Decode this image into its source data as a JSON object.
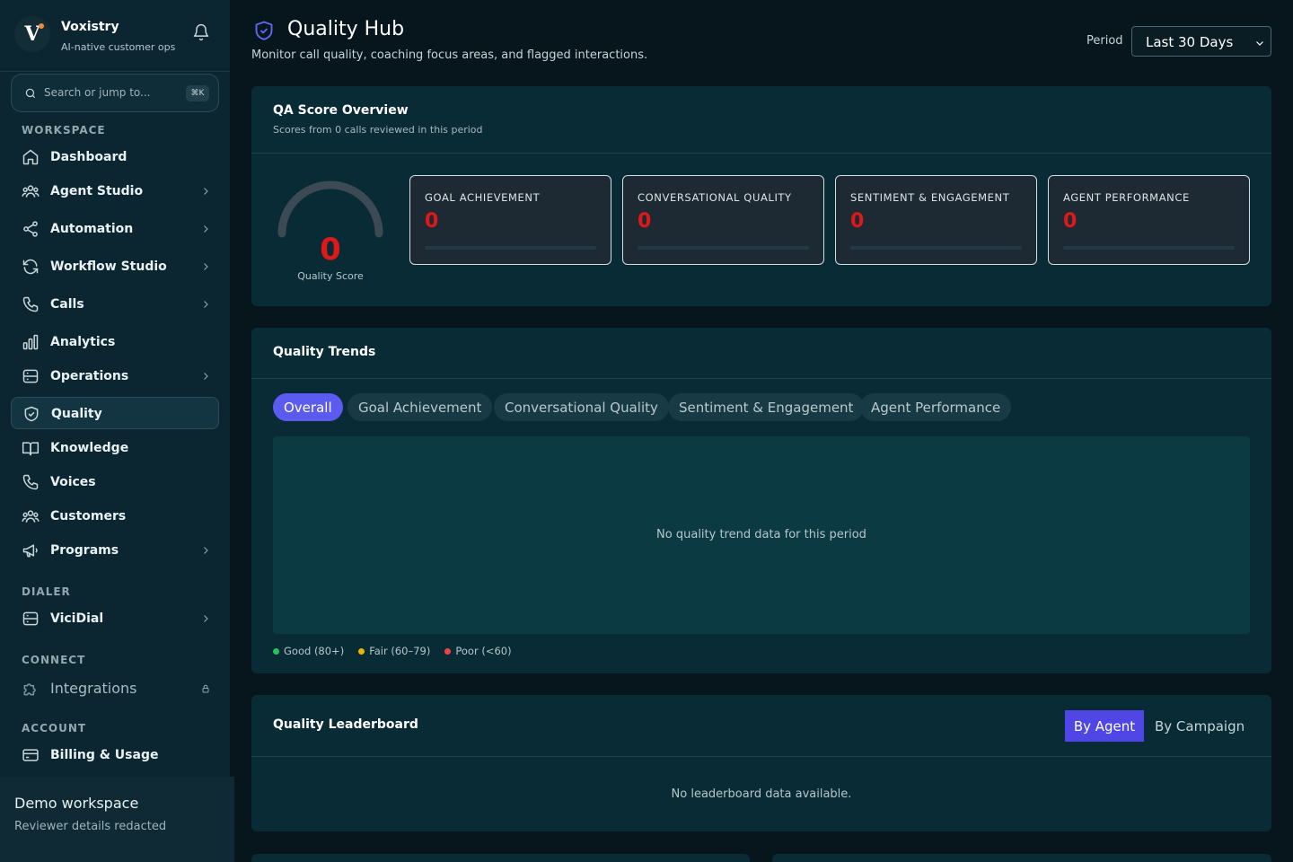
{
  "brand": {
    "logo_letter": "V",
    "name": "Voxistry",
    "tagline": "AI-native customer ops"
  },
  "search": {
    "placeholder": "Search or jump to...",
    "shortcut": "⌘K"
  },
  "sidebar": {
    "sections": {
      "workspace": "WORKSPACE",
      "dialer": "DIALER",
      "connect": "CONNECT",
      "account": "ACCOUNT"
    },
    "items": [
      {
        "label": "Dashboard",
        "icon": "home-icon"
      },
      {
        "label": "Agent Studio",
        "icon": "users-icon",
        "has_children": true
      },
      {
        "label": "Automation",
        "icon": "share-icon",
        "has_children": true
      },
      {
        "label": "Workflow Studio",
        "icon": "refresh-icon",
        "has_children": true
      },
      {
        "label": "Calls",
        "icon": "phone-icon",
        "has_children": true
      },
      {
        "label": "Analytics",
        "icon": "bar-chart-icon"
      },
      {
        "label": "Operations",
        "icon": "server-icon",
        "has_children": true
      },
      {
        "label": "Quality",
        "icon": "shield-check-icon",
        "active": true
      },
      {
        "label": "Knowledge",
        "icon": "book-icon"
      },
      {
        "label": "Voices",
        "icon": "phone-icon"
      },
      {
        "label": "Customers",
        "icon": "users-icon"
      },
      {
        "label": "Programs",
        "icon": "megaphone-icon",
        "has_children": true
      },
      {
        "label": "ViciDial",
        "icon": "server-icon",
        "has_children": true
      },
      {
        "label": "Integrations",
        "icon": "puzzle-icon",
        "locked": true
      },
      {
        "label": "Billing & Usage",
        "icon": "credit-card-icon"
      }
    ]
  },
  "workspace": {
    "name": "Demo workspace",
    "subtitle": "Reviewer details redacted"
  },
  "header": {
    "title": "Quality Hub",
    "subtitle": "Monitor call quality, coaching focus areas, and flagged interactions.",
    "period_label": "Period",
    "period_value": "Last 30 Days"
  },
  "qa_overview": {
    "title": "QA Score Overview",
    "subtitle": "Scores from 0 calls reviewed in this period",
    "score": "0",
    "score_label": "Quality Score",
    "metrics": [
      {
        "label": "GOAL ACHIEVEMENT",
        "value": "0"
      },
      {
        "label": "CONVERSATIONAL QUALITY",
        "value": "0"
      },
      {
        "label": "SENTIMENT & ENGAGEMENT",
        "value": "0"
      },
      {
        "label": "AGENT PERFORMANCE",
        "value": "0"
      }
    ]
  },
  "trends": {
    "title": "Quality Trends",
    "tabs": [
      "Overall",
      "Goal Achievement",
      "Conversational Quality",
      "Sentiment & Engagement",
      "Agent Performance"
    ],
    "active_tab": "Overall",
    "empty_message": "No quality trend data for this period",
    "legend": [
      {
        "label": "Good (80+)",
        "color": "#22c55e"
      },
      {
        "label": "Fair (60–79)",
        "color": "#eab308"
      },
      {
        "label": "Poor (<60)",
        "color": "#ef4444"
      }
    ]
  },
  "leaderboard": {
    "title": "Quality Leaderboard",
    "toggle": [
      "By Agent",
      "By Campaign"
    ],
    "active": "By Agent",
    "empty_message": "No leaderboard data available."
  },
  "colors": {
    "accent": "#5b5bf0",
    "toggle_active": "#4f46e5",
    "score_red": "#e01818"
  }
}
